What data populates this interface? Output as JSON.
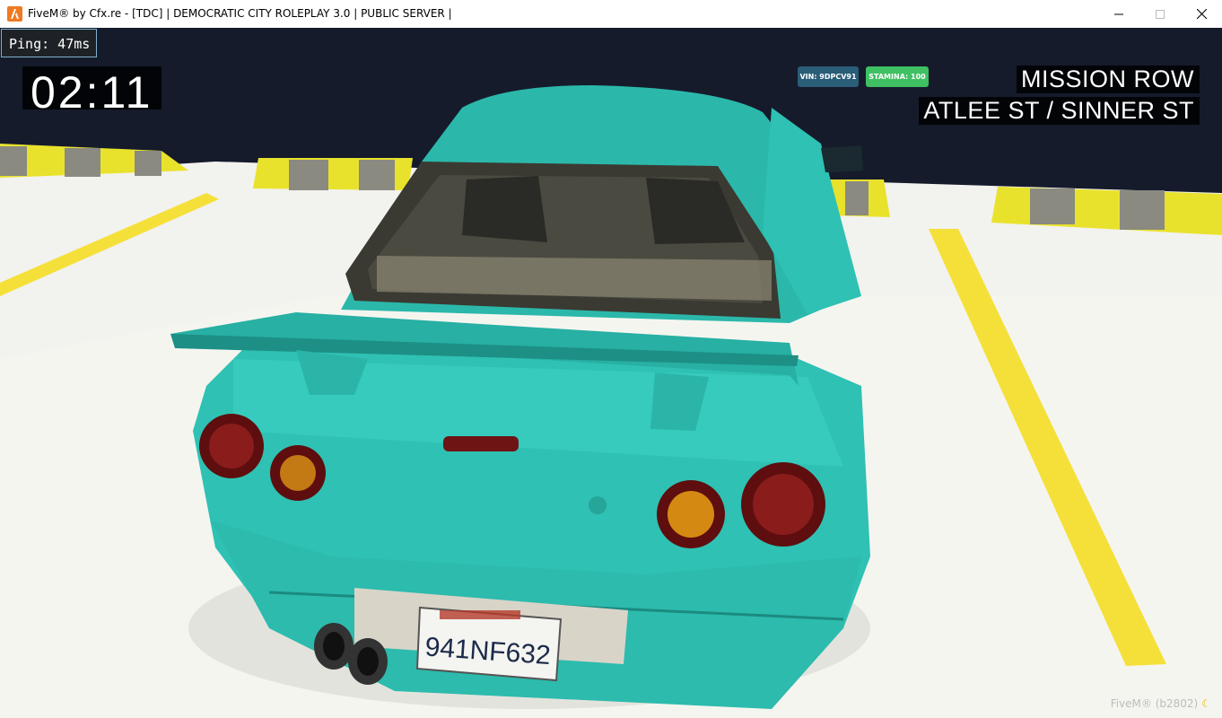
{
  "window": {
    "title": "FiveM® by Cfx.re - [TDC] | DEMOCRATIC CITY ROLEPLAY 3.0 | PUBLIC SERVER |",
    "icon": "fivem-icon",
    "controls": {
      "minimize": "minimize-icon",
      "maximize": "maximize-icon",
      "close": "close-icon"
    }
  },
  "hud": {
    "ping": "Ping: 47ms",
    "clock": "02:11",
    "vin": "VIN: 9DPCV91",
    "stamina": "STAMINA: 100",
    "zone": "MISSION ROW",
    "roads": "ATLEE ST / SINNER ST",
    "build": "FiveM® (b2802)",
    "build_icon": "moon-icon"
  },
  "vehicle": {
    "license_plate": "941NF632",
    "body_color": "#2fc1b3"
  },
  "colors": {
    "sky": "#151b2b",
    "ground": "#f2f2ef",
    "lane_yellow": "#f5e03a",
    "hud_vin": "#2a5d78",
    "hud_stamina": "#3fc063"
  }
}
